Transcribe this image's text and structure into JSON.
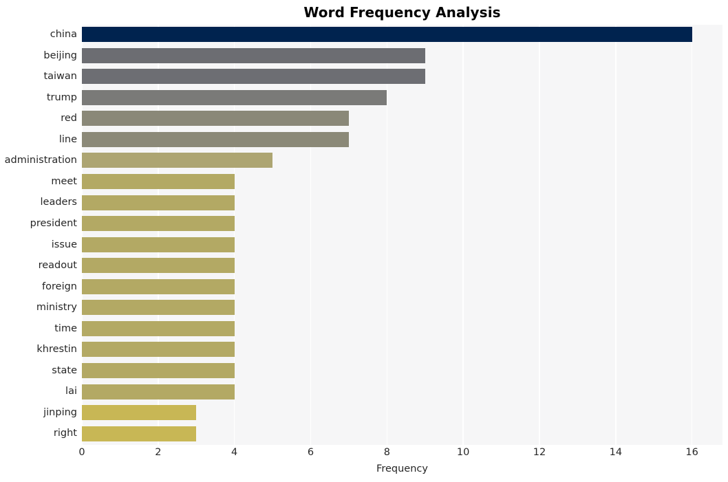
{
  "chart_data": {
    "type": "bar",
    "orientation": "horizontal",
    "title": "Word Frequency Analysis",
    "xlabel": "Frequency",
    "ylabel": "",
    "categories": [
      "china",
      "beijing",
      "taiwan",
      "trump",
      "red",
      "line",
      "administration",
      "meet",
      "leaders",
      "president",
      "issue",
      "readout",
      "foreign",
      "ministry",
      "time",
      "khrestin",
      "state",
      "lai",
      "jinping",
      "right"
    ],
    "values": [
      16,
      9,
      9,
      8,
      7,
      7,
      5,
      4,
      4,
      4,
      4,
      4,
      4,
      4,
      4,
      4,
      4,
      4,
      3,
      3
    ],
    "bar_colors": [
      "#00234f",
      "#6c6d72",
      "#6d6e73",
      "#7a7a78",
      "#8a8878",
      "#8b8978",
      "#ada572",
      "#b3a964",
      "#b3a964",
      "#b3a964",
      "#b3a964",
      "#b3a964",
      "#b3a964",
      "#b3a964",
      "#b3a964",
      "#b3a964",
      "#b3a964",
      "#b3a964",
      "#c8b755",
      "#c8b755"
    ],
    "xticks": [
      0,
      2,
      4,
      6,
      8,
      10,
      12,
      14,
      16
    ],
    "xlim": [
      0,
      16.8
    ],
    "grid": true,
    "grid_color": "#ffffff",
    "plot_background": "#f6f6f7",
    "figure_background": "#ffffff",
    "legend": null,
    "colormap": "cividis"
  },
  "axes": {
    "x_tick_labels": [
      "0",
      "2",
      "4",
      "6",
      "8",
      "10",
      "12",
      "14",
      "16"
    ],
    "y_tick_labels": [
      "china",
      "beijing",
      "taiwan",
      "trump",
      "red",
      "line",
      "administration",
      "meet",
      "leaders",
      "president",
      "issue",
      "readout",
      "foreign",
      "ministry",
      "time",
      "khrestin",
      "state",
      "lai",
      "jinping",
      "right"
    ]
  }
}
